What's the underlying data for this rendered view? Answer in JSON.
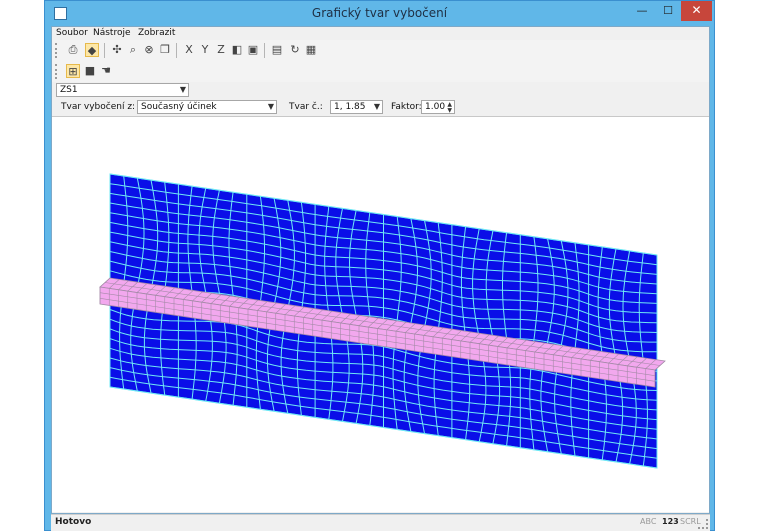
{
  "window": {
    "title": "Grafický tvar vybočení",
    "controls": {
      "minimize": "—",
      "maximize": "☐",
      "close": "✕"
    }
  },
  "menu": [
    "Soubor",
    "Nástroje",
    "Zobrazit"
  ],
  "toolbar1": {
    "icons": [
      "print-icon",
      "render-icon",
      "pointer-icon",
      "zoom-icon",
      "zoom-reset-icon",
      "copy-icon",
      "view-x-icon",
      "view-y-icon",
      "view-z-icon",
      "isometric-icon",
      "view-3d-icon",
      "active-view-icon",
      "rotate-icon",
      "print-preview-icon"
    ]
  },
  "toolbar2": {
    "icons": [
      "mesh-icon",
      "color-icon",
      "hand-icon"
    ]
  },
  "load_case": {
    "value": "ZS1"
  },
  "buckling": {
    "shape_from_label": "Tvar vybočení z:",
    "shape_from_value": "Současný účinek",
    "shape_no_label": "Tvar č.:",
    "shape_no_value": "1, 1.85",
    "factor_label": "Faktor:",
    "factor_value": "1.00"
  },
  "status": {
    "text": "Hotovo",
    "indicators": [
      "ABC",
      "123",
      "SCRL"
    ],
    "active_indicator": "123"
  },
  "colors": {
    "plate_fill": "#0a0ee8",
    "plate_mesh": "#6fe8f5",
    "stiffener_fill": "#f2a8ee",
    "stiffener_mesh": "#a58aa8",
    "title_bar": "#60b7e8",
    "close_button": "#c7463b"
  }
}
